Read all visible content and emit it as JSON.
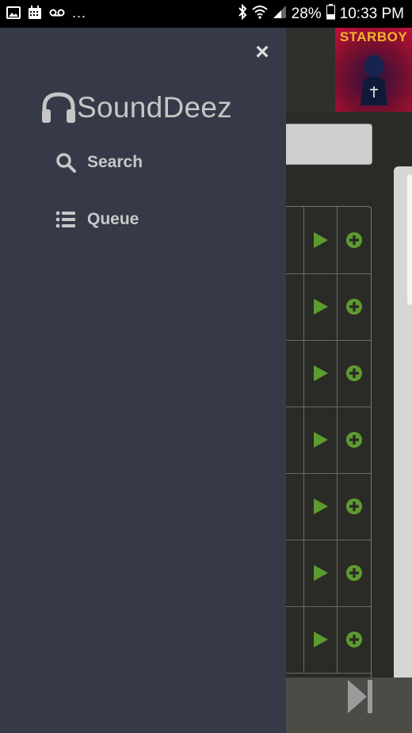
{
  "status_bar": {
    "overflow": "...",
    "battery": "28%",
    "time": "10:33 PM",
    "icons": [
      "image-icon",
      "calendar-icon",
      "voicemail-icon",
      "bluetooth-icon",
      "wifi-icon",
      "signal-icon",
      "battery-icon"
    ]
  },
  "drawer": {
    "close_label": "×",
    "brand": "SoundDeez",
    "brand_icon": "headphones-icon",
    "nav": [
      {
        "label": "Search",
        "icon": "search-icon"
      },
      {
        "label": "Queue",
        "icon": "list-icon"
      }
    ]
  },
  "now_playing": {
    "album_title": "STARBOY"
  },
  "tracks": {
    "row_count": 7,
    "play_icon": "play-icon",
    "add_icon": "plus-circle-icon"
  },
  "colors": {
    "drawer_bg": "#363947",
    "accent_green": "#5e9b2f",
    "text_light": "#c8c8c8"
  }
}
